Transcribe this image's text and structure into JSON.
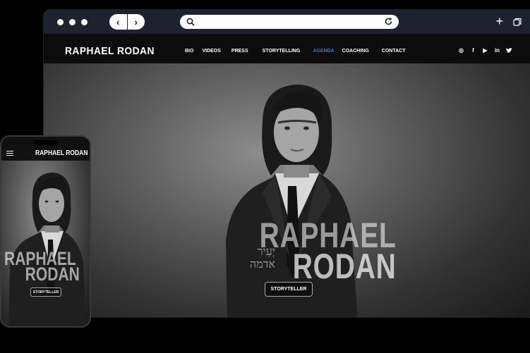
{
  "browser": {
    "icons": [
      "window-dot",
      "back-arrow",
      "forward-arrow",
      "search-icon",
      "reload-icon",
      "new-tab-icon",
      "tabs-icon"
    ],
    "back_glyph": "‹",
    "forward_glyph": "›",
    "plus_glyph": "+"
  },
  "site": {
    "logo": "RAPHAEL RODAN",
    "menu": [
      {
        "label": "BIO",
        "active": false
      },
      {
        "label": "VIDEOS",
        "active": false
      },
      {
        "label": "PRESS",
        "active": false
      },
      {
        "label": "STORYTELLING",
        "active": false
      },
      {
        "label": "AGENDA",
        "active": true
      },
      {
        "label": "COACHING",
        "active": false
      },
      {
        "label": "CONTACT",
        "active": false
      }
    ],
    "social": [
      "instagram-icon",
      "facebook-icon",
      "youtube-icon",
      "linkedin-icon",
      "twitter-icon"
    ],
    "social_glyphs": [
      "◎",
      "f",
      "▶",
      "in",
      "🐦"
    ],
    "hero": {
      "title_line1": "RAPHAEL",
      "title_line2": "RODAN",
      "hebrew_line1": "יְעִיר",
      "hebrew_line2": "אדמה",
      "cta": "STORYTELLER"
    }
  },
  "phone": {
    "logo": "RAPHAEL RODAN",
    "title_line1": "RAPHAEL",
    "title_line2": "RODAN",
    "cta": "STORYTELLER"
  },
  "colors": {
    "accent": "#1a7fd0",
    "browser_bar": "#1c2230",
    "background": "#000000"
  }
}
